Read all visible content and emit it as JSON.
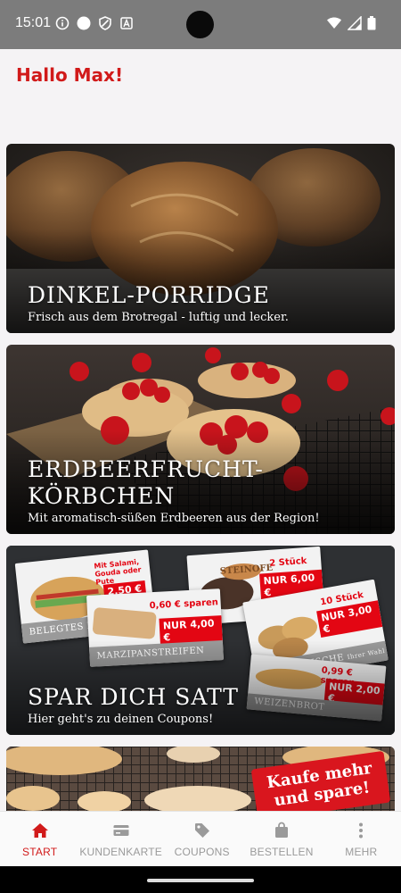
{
  "status_bar": {
    "time": "15:01",
    "left_icons": [
      "info-icon",
      "circle-icon",
      "shield-icon",
      "font-icon"
    ],
    "right_icons": [
      "wifi-icon",
      "signal-icon",
      "battery-icon"
    ]
  },
  "header": {
    "greeting": "Hallo Max!"
  },
  "cards": [
    {
      "title": "DINKEL-PORRIDGE",
      "subtitle": "Frisch aus dem Brotregal - luftig und lecker."
    },
    {
      "title": "ERDBEERFRUCHT-\nKÖRBCHEN",
      "subtitle": "Mit aromatisch-süßen Erdbeeren aus der Region!"
    },
    {
      "title": "SPAR DICH SATT",
      "subtitle": "Hier geht's zu deinen Coupons!"
    },
    {
      "ribbon": "Kaufe mehr\nund spare!"
    }
  ],
  "coupons": {
    "belegtes": {
      "label": "BELEGTES K",
      "note": "Mit Salami, Gouda oder Pute",
      "price": "2,50 €"
    },
    "steinofen": {
      "brand": "STEINOFE",
      "note": "2 Stück",
      "price": "NUR 6,00 €"
    },
    "marzipan": {
      "label": "MARZIPANSTREIFEN",
      "note": "0,60 € sparen",
      "price": "NUR 4,00 €"
    },
    "knack": {
      "label": "KNACKFRISCHE",
      "label_small": "Ihrer Wahl",
      "note": "10 Stück",
      "price": "NUR 3,00 €"
    },
    "weizen": {
      "label": "WEIZENBROT",
      "note": "0,99 € sparen",
      "price": "NUR 2,00 €"
    }
  },
  "bottom_nav": [
    {
      "label": "START",
      "icon": "home-icon",
      "active": true
    },
    {
      "label": "KUNDENKARTE",
      "icon": "card-icon",
      "active": false
    },
    {
      "label": "COUPONS",
      "icon": "tag-icon",
      "active": false
    },
    {
      "label": "BESTELLEN",
      "icon": "bag-icon",
      "active": false
    },
    {
      "label": "MEHR",
      "icon": "more-vertical-icon",
      "active": false
    }
  ],
  "colors": {
    "brand_red": "#d11a1a",
    "coupon_red": "#e30613",
    "status_bar": "#7c7c7c",
    "nav_inactive": "#9a9a9a"
  }
}
